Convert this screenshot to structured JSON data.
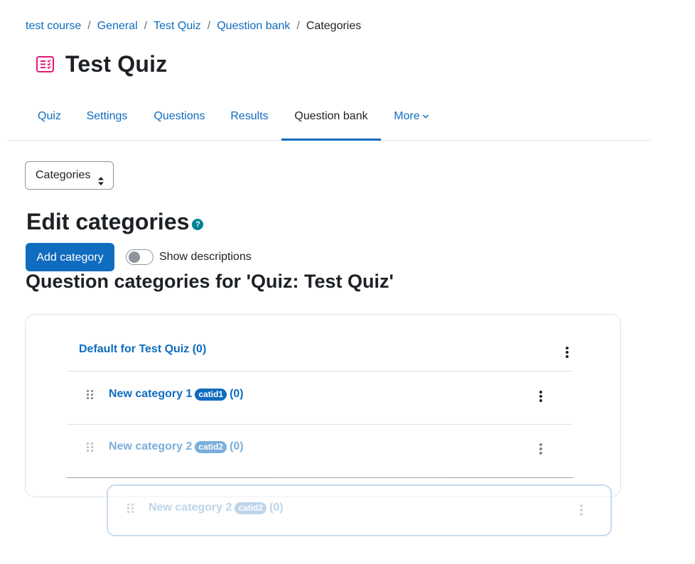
{
  "breadcrumb": [
    "test course",
    "General",
    "Test Quiz",
    "Question bank",
    "Categories"
  ],
  "breadcrumb_separator": "/",
  "page": {
    "title": "Test Quiz"
  },
  "tabs": [
    {
      "label": "Quiz"
    },
    {
      "label": "Settings"
    },
    {
      "label": "Questions"
    },
    {
      "label": "Results"
    },
    {
      "label": "Question bank",
      "active": true
    },
    {
      "label": "More"
    }
  ],
  "select": {
    "value": "Categories"
  },
  "edit_heading": "Edit categories",
  "help_icon_glyph": "?",
  "add_button": "Add category",
  "toggle": {
    "label": "Show descriptions",
    "checked": false
  },
  "context_heading": "Question categories for 'Quiz: Test Quiz'",
  "categories": {
    "default": {
      "name": "Default for Test Quiz",
      "count": "(0)"
    },
    "items": [
      {
        "name": "New category 1",
        "idnumber": "catid1",
        "count": "(0)"
      },
      {
        "name": "New category 2",
        "idnumber": "catid2",
        "count": "(0)"
      }
    ]
  },
  "dragging": {
    "name": "New category 2",
    "idnumber": "catid2",
    "count": "(0)"
  },
  "colors": {
    "primary": "#0f6cbf",
    "help": "#008196",
    "quiz_icon": "#e1197b",
    "text": "#1d2125"
  }
}
